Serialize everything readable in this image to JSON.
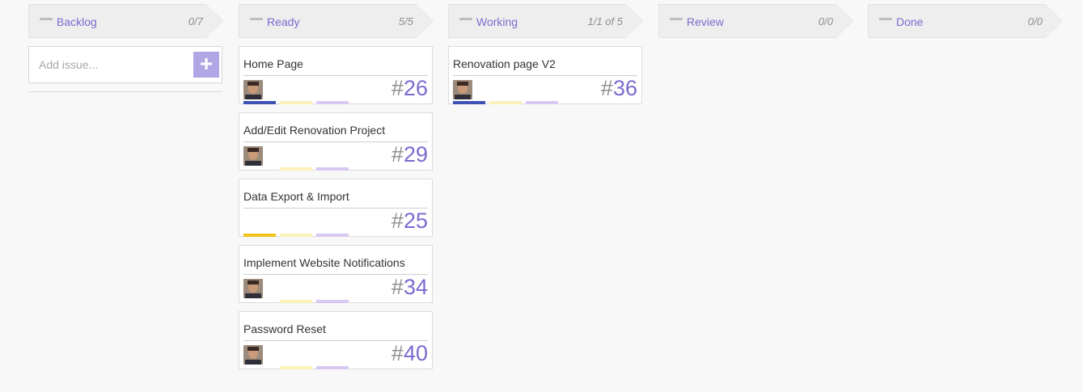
{
  "columns": [
    {
      "title": "Backlog",
      "count": "0/7"
    },
    {
      "title": "Ready",
      "count": "5/5"
    },
    {
      "title": "Working",
      "count": "1/1 of 5"
    },
    {
      "title": "Review",
      "count": "0/0"
    },
    {
      "title": "Done",
      "count": "0/0"
    }
  ],
  "backlog": {
    "add_placeholder": "Add issue...",
    "add_button": "+"
  },
  "ready_cards": [
    {
      "title": "Home Page",
      "hash": "#",
      "number": "26",
      "avatar": "person-avatar",
      "bars": [
        "#3f51b5",
        "#fbf1bb",
        "#d9c9f2"
      ]
    },
    {
      "title": "Add/Edit Renovation Project",
      "hash": "#",
      "number": "29",
      "avatar": "person-avatar",
      "bars": [
        "#fbf1bb",
        "#d9c9f2"
      ]
    },
    {
      "title": "Data Export & Import",
      "hash": "#",
      "number": "25",
      "avatar": "",
      "bars": [
        "#f0c419",
        "#fbf1bb",
        "#d9c9f2"
      ]
    },
    {
      "title": "Implement Website Notifications",
      "hash": "#",
      "number": "34",
      "avatar": "person-avatar",
      "bars": [
        "#fbf1bb",
        "#d9c9f2"
      ]
    },
    {
      "title": "Password Reset",
      "hash": "#",
      "number": "40",
      "avatar": "person-avatar",
      "bars": [
        "#fbf1bb",
        "#d9c9f2"
      ]
    }
  ],
  "working_cards": [
    {
      "title": "Renovation page V2",
      "hash": "#",
      "number": "36",
      "avatar": "person-avatar",
      "bars": [
        "#3f51b5",
        "#fbf1bb",
        "#d9c9f2"
      ]
    }
  ],
  "colors": {
    "accent": "#7b6bd0",
    "add_button": "#b2a7e5",
    "header_bg": "#eeeeee"
  }
}
